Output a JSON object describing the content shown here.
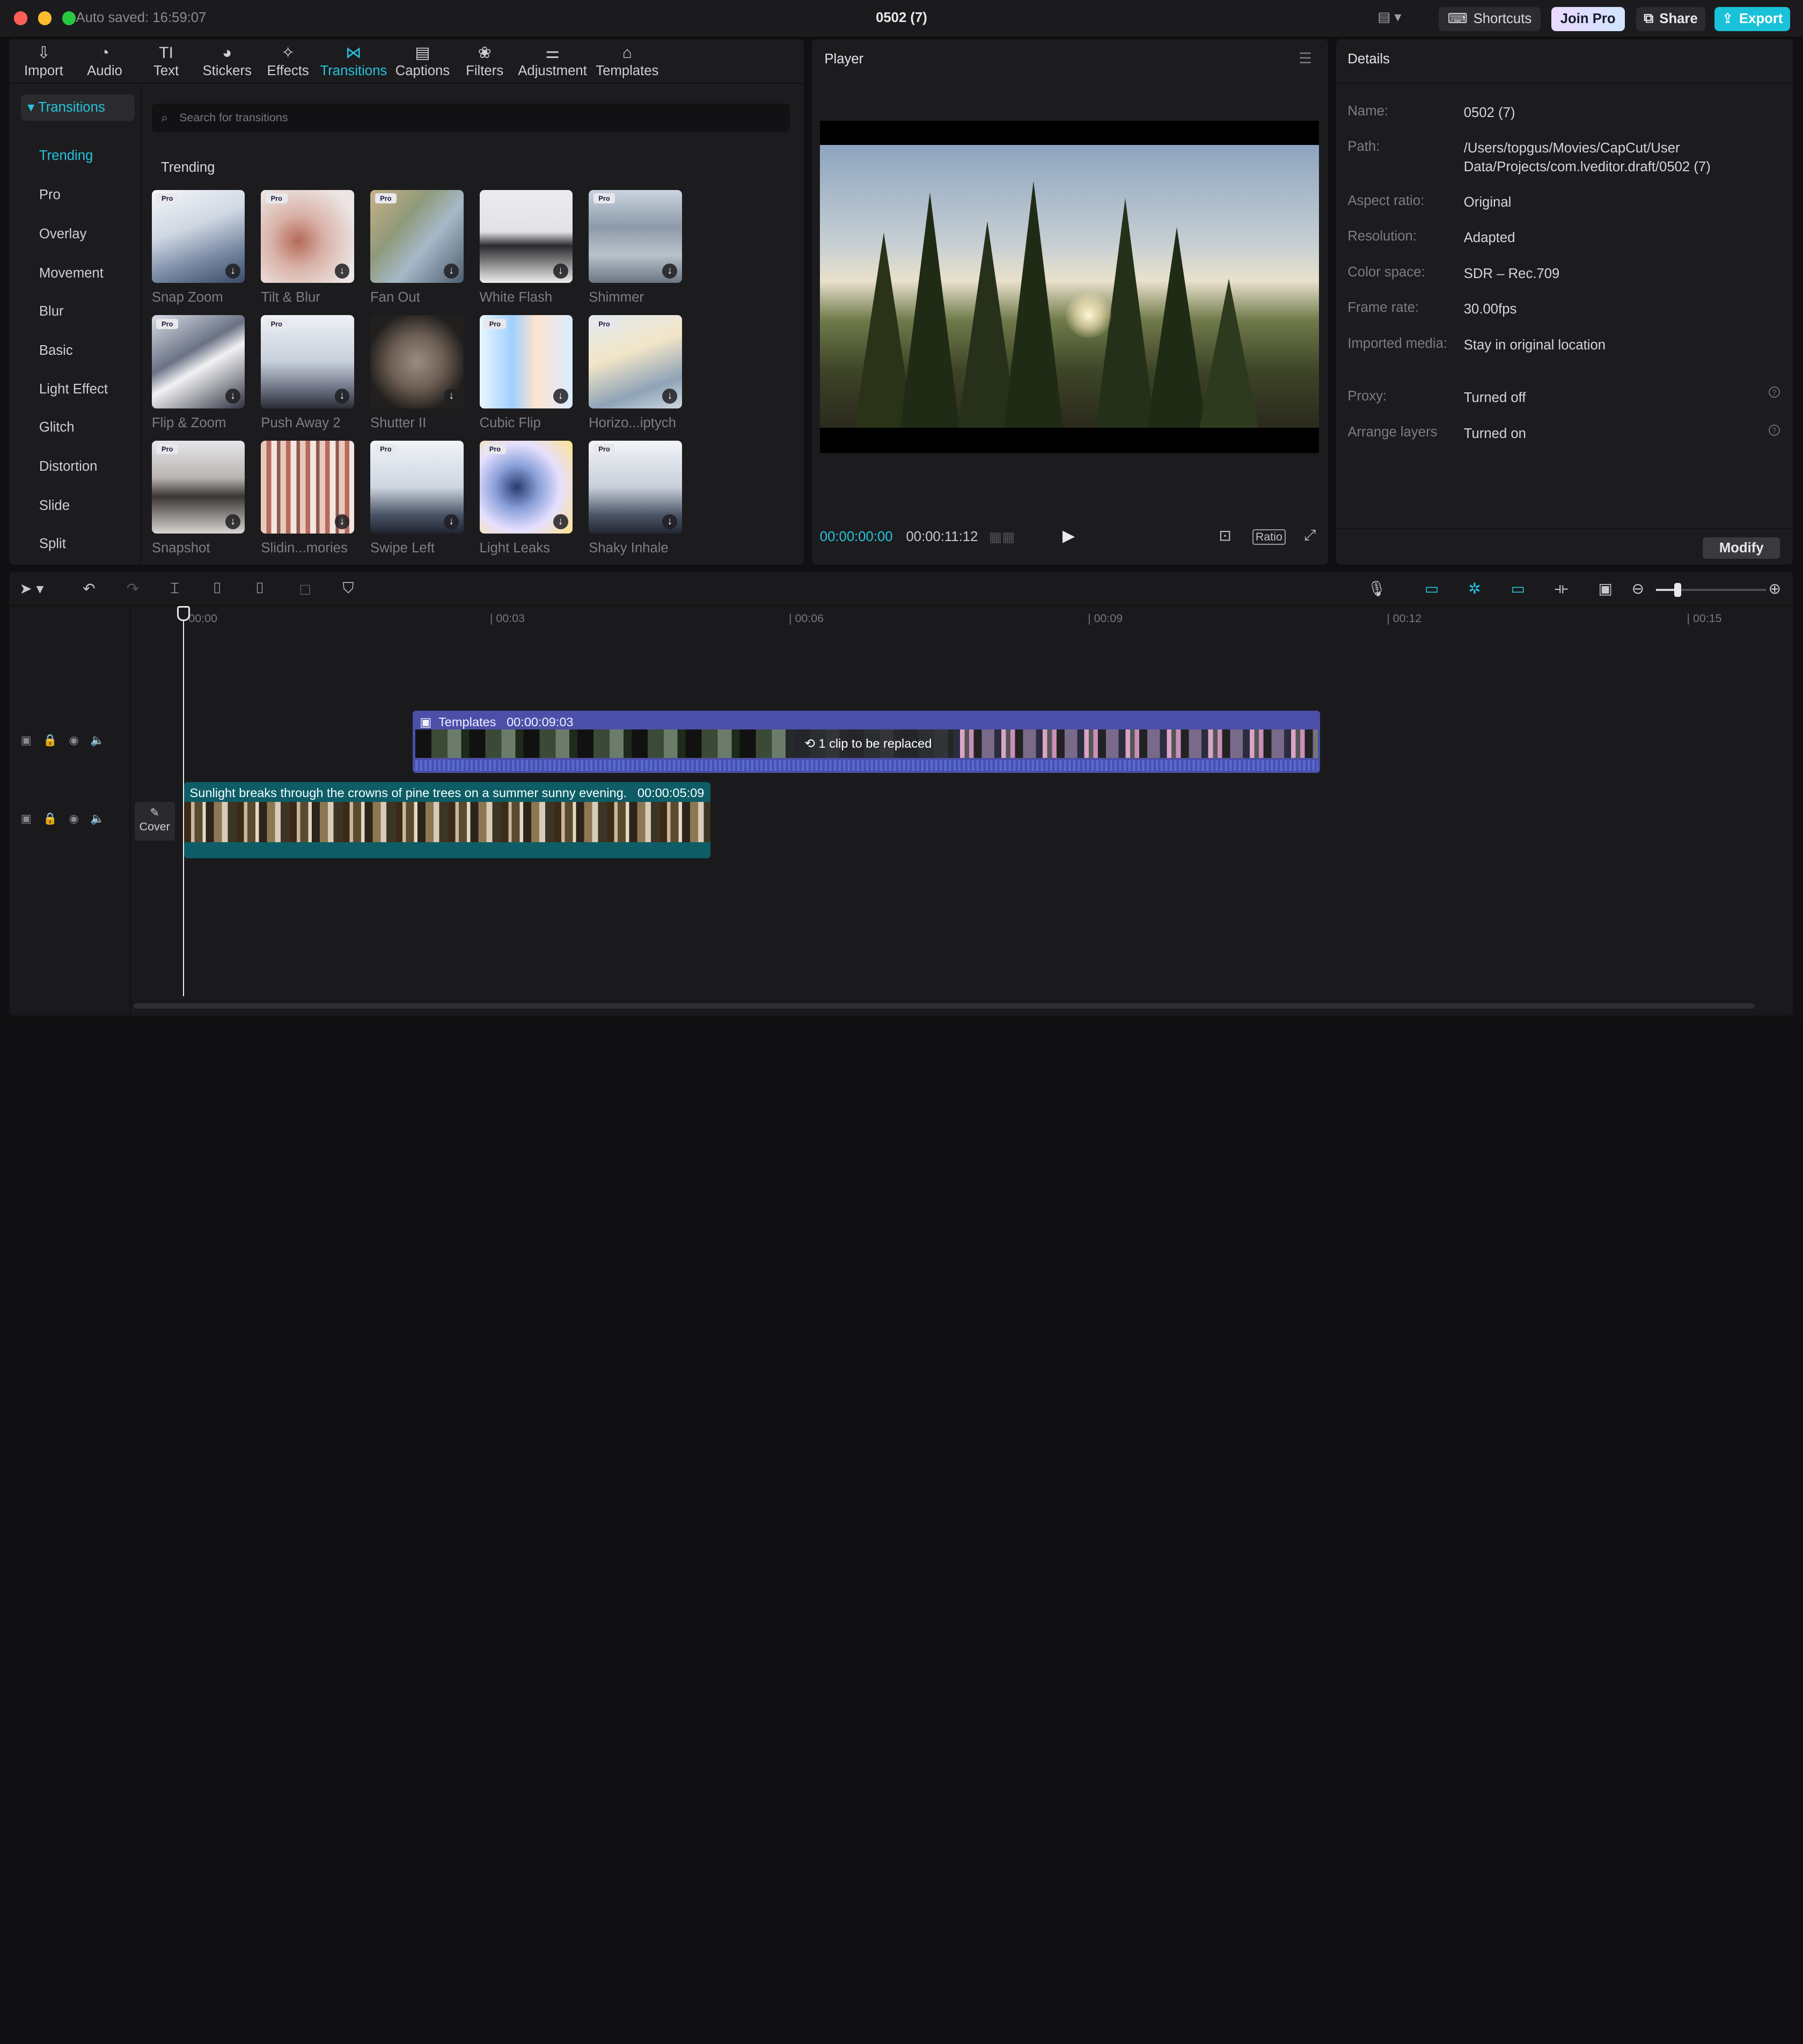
{
  "titlebar": {
    "autosave": "Auto saved: 16:59:07",
    "title": "0502 (7)",
    "shortcuts": "Shortcuts",
    "join_pro": "Join Pro",
    "share": "Share",
    "export": "Export"
  },
  "media_tabs": [
    {
      "label": "Import",
      "icon": "import-icon"
    },
    {
      "label": "Audio",
      "icon": "audio-icon"
    },
    {
      "label": "Text",
      "icon": "text-icon"
    },
    {
      "label": "Stickers",
      "icon": "stickers-icon"
    },
    {
      "label": "Effects",
      "icon": "effects-icon"
    },
    {
      "label": "Transitions",
      "icon": "transitions-icon",
      "active": true
    },
    {
      "label": "Captions",
      "icon": "captions-icon"
    },
    {
      "label": "Filters",
      "icon": "filters-icon"
    },
    {
      "label": "Adjustment",
      "icon": "adjustment-icon"
    },
    {
      "label": "Templates",
      "icon": "templates-icon"
    }
  ],
  "sidebar": {
    "header": "Transitions",
    "items": [
      "Trending",
      "Pro",
      "Overlay",
      "Movement",
      "Blur",
      "Basic",
      "Light Effect",
      "Glitch",
      "Distortion",
      "Slide",
      "Split"
    ]
  },
  "search": {
    "placeholder": "Search for transitions"
  },
  "section_title": "Trending",
  "transitions": [
    {
      "label": "Snap Zoom",
      "pro": true
    },
    {
      "label": "Tilt & Blur",
      "pro": true
    },
    {
      "label": "Fan Out",
      "pro": true
    },
    {
      "label": "White Flash",
      "pro": false
    },
    {
      "label": "Shimmer",
      "pro": true
    },
    {
      "label": "Flip & Zoom",
      "pro": true
    },
    {
      "label": "Push Away 2",
      "pro": true
    },
    {
      "label": "Shutter II",
      "pro": false
    },
    {
      "label": "Cubic Flip",
      "pro": true
    },
    {
      "label": "Horizo...iptych",
      "pro": true
    },
    {
      "label": "Snapshot",
      "pro": true
    },
    {
      "label": "Slidin...mories",
      "pro": false
    },
    {
      "label": "Swipe Left",
      "pro": true
    },
    {
      "label": "Light Leaks",
      "pro": true
    },
    {
      "label": "Shaky Inhale",
      "pro": true
    }
  ],
  "pro_badge": "Pro",
  "player": {
    "title": "Player",
    "current_time": "00:00:00:00",
    "total_time": "00:00:11:12",
    "ratio": "Ratio"
  },
  "details": {
    "title": "Details",
    "rows": [
      {
        "key": "Name:",
        "value": "0502 (7)"
      },
      {
        "key": "Path:",
        "value": "/Users/topgus/Movies/CapCut/User Data/Projects/com.lveditor.draft/0502 (7)"
      },
      {
        "key": "Aspect ratio:",
        "value": "Original"
      },
      {
        "key": "Resolution:",
        "value": "Adapted"
      },
      {
        "key": "Color space:",
        "value": "SDR – Rec.709"
      },
      {
        "key": "Frame rate:",
        "value": "30.00fps"
      },
      {
        "key": "Imported media:",
        "value": "Stay in original location"
      },
      {
        "key": "Proxy:",
        "value": "Turned off"
      },
      {
        "key": "Arrange layers",
        "value": "Turned on"
      }
    ],
    "modify": "Modify"
  },
  "timeline": {
    "ruler": [
      "00:00",
      "00:03",
      "00:06",
      "00:09",
      "00:12",
      "00:15"
    ],
    "zoom_level": 0.2,
    "cover": "Cover",
    "template_clip": {
      "label": "Templates",
      "duration": "00:00:09:03",
      "replace": "1 clip to be replaced"
    },
    "main_clip": {
      "label": "Sunlight breaks through the crowns of pine trees on a summer sunny evening.",
      "duration": "00:00:05:09"
    }
  },
  "colors": {
    "accent": "#27c4dd",
    "export": "#19c2d8",
    "template_clip": "#4b4fa8",
    "main_clip": "#0e5d66"
  }
}
